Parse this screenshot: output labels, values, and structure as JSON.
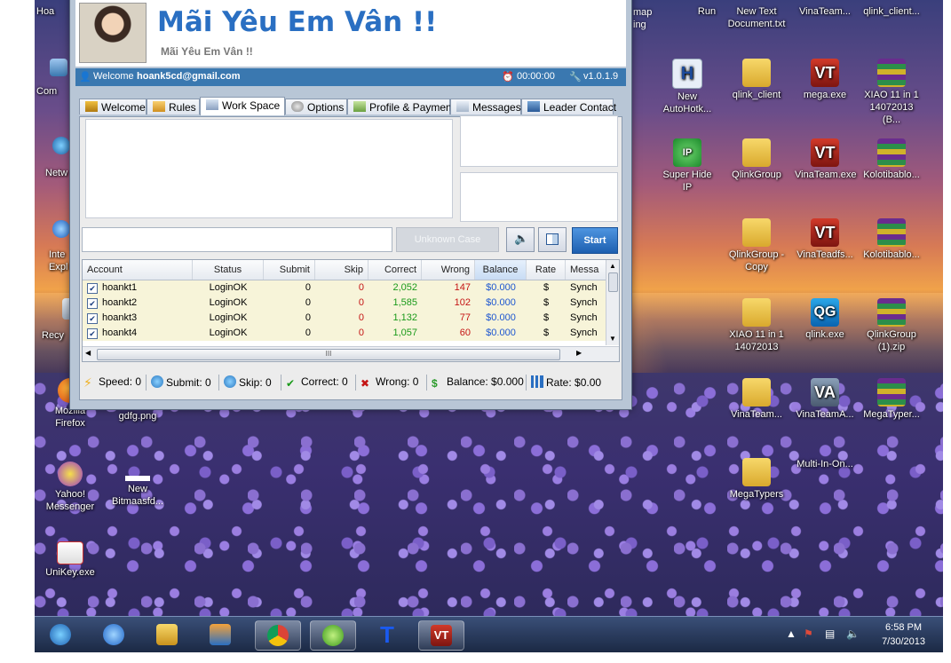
{
  "app": {
    "title": "Mãi Yêu Em Vân !!",
    "subtitle": "Mãi Yêu Em Vân !!",
    "welcome_prefix": "Welcome",
    "email": "hoank5cd@gmail.com",
    "timer": "00:00:00",
    "version": "v1.0.1.9",
    "tabs": [
      "Welcome",
      "Rules",
      "Work Space",
      "Options",
      "Profile & Payment",
      "Messages",
      "Leader Contact"
    ],
    "case_button": "Unknown Case",
    "start_button": "Start",
    "columns": [
      "Account",
      "Status",
      "Submit",
      "Skip",
      "Correct",
      "Wrong",
      "Balance",
      "Rate",
      "Messa"
    ],
    "rows": [
      {
        "account": "hoankt1",
        "status": "LoginOK",
        "submit": "0",
        "skip": "0",
        "correct": "2,052",
        "wrong": "147",
        "balance": "$0.000",
        "rate": "$",
        "message": "Synch"
      },
      {
        "account": "hoankt2",
        "status": "LoginOK",
        "submit": "0",
        "skip": "0",
        "correct": "1,585",
        "wrong": "102",
        "balance": "$0.000",
        "rate": "$",
        "message": "Synch"
      },
      {
        "account": "hoankt3",
        "status": "LoginOK",
        "submit": "0",
        "skip": "0",
        "correct": "1,132",
        "wrong": "77",
        "balance": "$0.000",
        "rate": "$",
        "message": "Synch"
      },
      {
        "account": "hoankt4",
        "status": "LoginOK",
        "submit": "0",
        "skip": "0",
        "correct": "1,057",
        "wrong": "60",
        "balance": "$0.000",
        "rate": "$",
        "message": "Synch"
      }
    ],
    "hscroll_grip": "III",
    "status": {
      "speed": "Speed: 0",
      "submit": "Submit: 0",
      "skip": "Skip: 0",
      "correct": "Correct: 0",
      "wrong": "Wrong: 0",
      "balance": "Balance: $0.000",
      "rate": "Rate: $0.00"
    }
  },
  "strip_right": {
    "line1": "map",
    "line2": "ing"
  },
  "desktop_left": {
    "hoa": "Hoa",
    "com": "Com",
    "netw": "Netw",
    "inte": "Inte",
    "expl": "Expl",
    "recy": "Recy",
    "firefox": "Mozilla Firefox",
    "gdfg": "gdfg.png",
    "yahoo": "Yahoo! Messenger",
    "bitmaas": "New Bitmaasfd...",
    "unikey": "UniKey.exe"
  },
  "desktop_right": [
    {
      "label": "Run",
      "kind": "none"
    },
    {
      "label": "New Text Document.txt",
      "kind": "none"
    },
    {
      "label": "VinaTeam...",
      "kind": "none"
    },
    {
      "label": "qlink_client...",
      "kind": "none"
    },
    {
      "label": "New AutoHotk...",
      "kind": "ahk"
    },
    {
      "label": "qlink_client",
      "kind": "folder"
    },
    {
      "label": "mega.exe",
      "kind": "vt"
    },
    {
      "label": "XIAO 11 in 1 14072013 (B...",
      "kind": "rar"
    },
    {
      "label": "Super Hide IP",
      "kind": "ip"
    },
    {
      "label": "QlinkGroup",
      "kind": "folder"
    },
    {
      "label": "VinaTeam.exe",
      "kind": "vt"
    },
    {
      "label": "Kolotibablo...",
      "kind": "rar"
    },
    {
      "label": "QlinkGroup - Copy",
      "kind": "folder"
    },
    {
      "label": "VinaTeadfs...",
      "kind": "vt"
    },
    {
      "label": "Kolotibablo...",
      "kind": "rar"
    },
    {
      "label": "XIAO 11 in 1 14072013",
      "kind": "folder"
    },
    {
      "label": "qlink.exe",
      "kind": "qg"
    },
    {
      "label": "QlinkGroup (1).zip",
      "kind": "rar"
    },
    {
      "label": "VinaTeam...",
      "kind": "folder"
    },
    {
      "label": "VinaTeamA...",
      "kind": "va"
    },
    {
      "label": "MegaTyper...",
      "kind": "rar"
    },
    {
      "label": "MegaTypers",
      "kind": "folder"
    },
    {
      "label": "Multi-In-On...",
      "kind": "none"
    }
  ],
  "clock": {
    "time": "6:58 PM",
    "date": "7/30/2013"
  },
  "colors": {
    "title_blue": "#2a6fc2",
    "correct_green": "#1a9a1a",
    "wrong_red": "#c41414",
    "balance_blue": "#1d56d0"
  }
}
